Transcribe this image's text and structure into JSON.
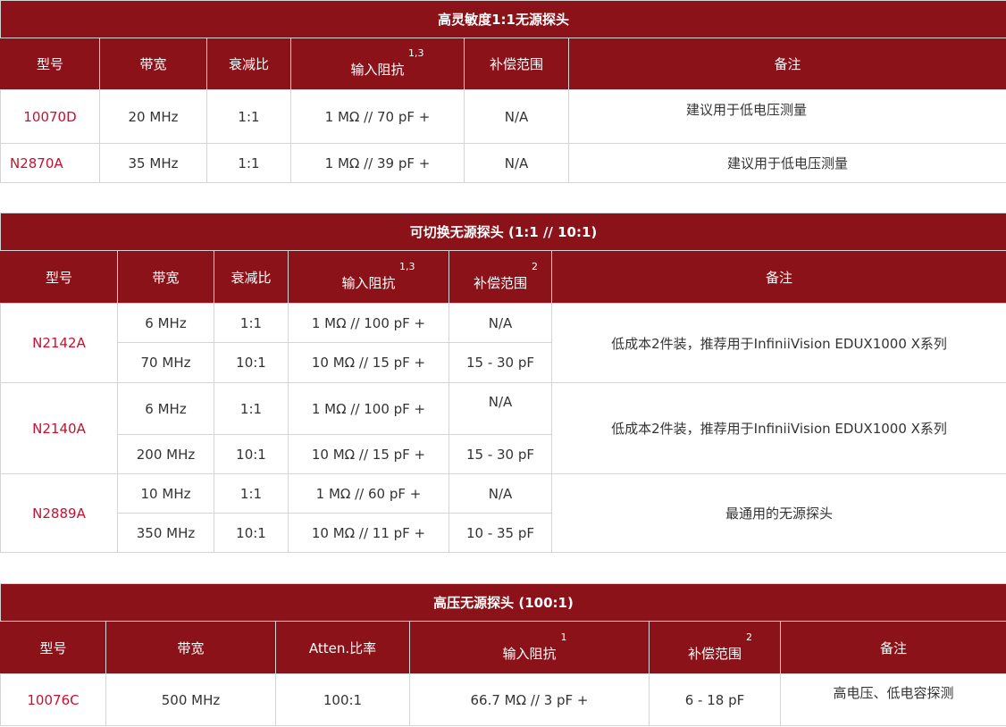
{
  "headers": {
    "model": "型号",
    "bandwidth": "带宽",
    "attenuation": "衰减比",
    "atten_ratio": "Atten.比率",
    "impedance": "输入阻抗",
    "compensation": "补偿范围",
    "notes": "备注"
  },
  "footnotes": {
    "impedance_1_3": "1,3",
    "impedance_1": "1",
    "compensation_2": "2"
  },
  "table1": {
    "title": "高灵敏度1:1无源探头",
    "rows": [
      {
        "model": "10070D",
        "bandwidth": "20 MHz",
        "attenuation": "1:1",
        "impedance": "1 MΩ // 70 pF +",
        "compensation": "N/A",
        "notes": "建议用于低电压测量"
      },
      {
        "model": "N2870A",
        "bandwidth": "35 MHz",
        "attenuation": "1:1",
        "impedance": "1 MΩ // 39 pF +",
        "compensation": "N/A",
        "notes": "建议用于低电压测量"
      }
    ]
  },
  "table2": {
    "title": "可切换无源探头 (1:1 // 10:1)",
    "groups": [
      {
        "model": "N2142A",
        "notes": "低成本2件装，推荐用于InfiniiVision EDUX1000 X系列",
        "rows": [
          {
            "bandwidth": "6 MHz",
            "attenuation": "1:1",
            "impedance": "1 MΩ // 100 pF +",
            "compensation": "N/A"
          },
          {
            "bandwidth": "70 MHz",
            "attenuation": "10:1",
            "impedance": "10 MΩ // 15 pF +",
            "compensation": "15 - 30 pF"
          }
        ]
      },
      {
        "model": "N2140A",
        "notes": "低成本2件装，推荐用于InfiniiVision EDUX1000 X系列",
        "rows": [
          {
            "bandwidth": "6 MHz",
            "attenuation": "1:1",
            "impedance": "1 MΩ // 100 pF +",
            "compensation": "N/A"
          },
          {
            "bandwidth": "200 MHz",
            "attenuation": "10:1",
            "impedance": "10 MΩ // 15 pF +",
            "compensation": "15 - 30 pF"
          }
        ]
      },
      {
        "model": "N2889A",
        "notes": "最通用的无源探头",
        "rows": [
          {
            "bandwidth": "10 MHz",
            "attenuation": "1:1",
            "impedance": "1 MΩ // 60 pF +",
            "compensation": "N/A"
          },
          {
            "bandwidth": "350 MHz",
            "attenuation": "10:1",
            "impedance": "10 MΩ // 11 pF +",
            "compensation": "10 - 35 pF"
          }
        ]
      }
    ]
  },
  "table3": {
    "title": "高压无源探头 (100:1)",
    "rows": [
      {
        "model": "10076C",
        "bandwidth": "500 MHz",
        "attenuation": "100:1",
        "impedance": "66.7 MΩ // 3 pF +",
        "compensation": "6 - 18 pF",
        "notes": "高电压、低电容探测"
      }
    ]
  },
  "colors": {
    "header_bg": "#8b1218",
    "model_link": "#c8102e",
    "border": "#d4d4d4"
  }
}
